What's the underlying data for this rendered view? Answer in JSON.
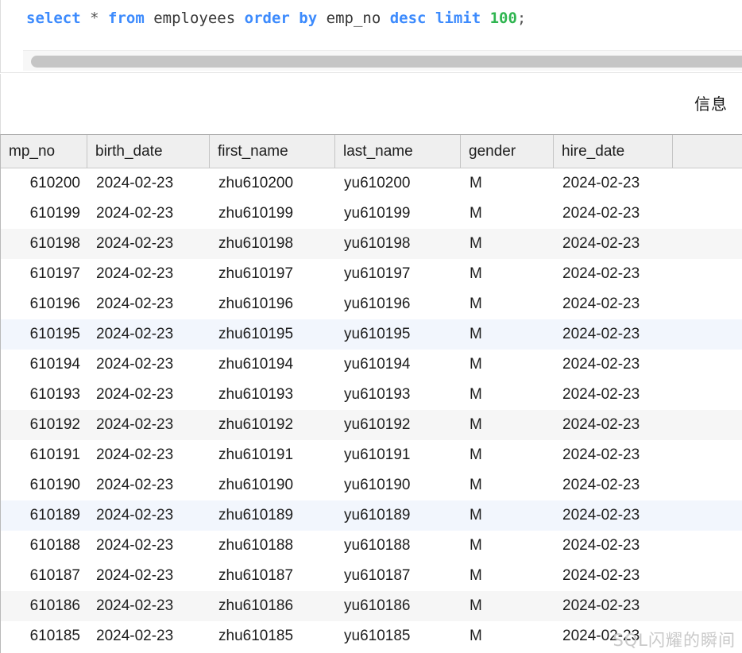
{
  "editor": {
    "query_tokens": [
      {
        "text": "select",
        "type": "keyword"
      },
      {
        "text": " ",
        "type": "plain"
      },
      {
        "text": "*",
        "type": "operator"
      },
      {
        "text": " ",
        "type": "plain"
      },
      {
        "text": "from",
        "type": "keyword"
      },
      {
        "text": " ",
        "type": "plain"
      },
      {
        "text": "employees",
        "type": "identifier"
      },
      {
        "text": " ",
        "type": "plain"
      },
      {
        "text": "order",
        "type": "keyword"
      },
      {
        "text": " ",
        "type": "plain"
      },
      {
        "text": "by",
        "type": "keyword"
      },
      {
        "text": " ",
        "type": "plain"
      },
      {
        "text": "emp_no",
        "type": "identifier"
      },
      {
        "text": " ",
        "type": "plain"
      },
      {
        "text": "desc",
        "type": "keyword"
      },
      {
        "text": " ",
        "type": "plain"
      },
      {
        "text": "limit",
        "type": "keyword"
      },
      {
        "text": " ",
        "type": "plain"
      },
      {
        "text": "100",
        "type": "number"
      },
      {
        "text": ";",
        "type": "punct"
      }
    ],
    "query_text": "select * from employees order by emp_no desc limit 100;"
  },
  "colors": {
    "keyword": "#3d8bfd",
    "number": "#2fb550",
    "identifier": "#383838",
    "stripe_gray": "#f6f6f6",
    "stripe_blue": "#f2f6fd",
    "header_bg": "#efefef"
  },
  "results": {
    "tab_label": "信息",
    "columns": [
      {
        "key": "emp_no",
        "label": "mp_no",
        "full_label": "emp_no",
        "align": "right"
      },
      {
        "key": "birth_date",
        "label": "birth_date",
        "full_label": "birth_date",
        "align": "left"
      },
      {
        "key": "first_name",
        "label": "first_name",
        "full_label": "first_name",
        "align": "left"
      },
      {
        "key": "last_name",
        "label": "last_name",
        "full_label": "last_name",
        "align": "left"
      },
      {
        "key": "gender",
        "label": "gender",
        "full_label": "gender",
        "align": "left"
      },
      {
        "key": "hire_date",
        "label": "hire_date",
        "full_label": "hire_date",
        "align": "left"
      },
      {
        "key": "spacer",
        "label": "",
        "full_label": "",
        "align": "left"
      }
    ],
    "rows": [
      {
        "emp_no": "610200",
        "birth_date": "2024-02-23",
        "first_name": "zhu610200",
        "last_name": "yu610200",
        "gender": "M",
        "hire_date": "2024-02-23",
        "stripe": "none"
      },
      {
        "emp_no": "610199",
        "birth_date": "2024-02-23",
        "first_name": "zhu610199",
        "last_name": "yu610199",
        "gender": "M",
        "hire_date": "2024-02-23",
        "stripe": "none"
      },
      {
        "emp_no": "610198",
        "birth_date": "2024-02-23",
        "first_name": "zhu610198",
        "last_name": "yu610198",
        "gender": "M",
        "hire_date": "2024-02-23",
        "stripe": "gray"
      },
      {
        "emp_no": "610197",
        "birth_date": "2024-02-23",
        "first_name": "zhu610197",
        "last_name": "yu610197",
        "gender": "M",
        "hire_date": "2024-02-23",
        "stripe": "none"
      },
      {
        "emp_no": "610196",
        "birth_date": "2024-02-23",
        "first_name": "zhu610196",
        "last_name": "yu610196",
        "gender": "M",
        "hire_date": "2024-02-23",
        "stripe": "none"
      },
      {
        "emp_no": "610195",
        "birth_date": "2024-02-23",
        "first_name": "zhu610195",
        "last_name": "yu610195",
        "gender": "M",
        "hire_date": "2024-02-23",
        "stripe": "blue"
      },
      {
        "emp_no": "610194",
        "birth_date": "2024-02-23",
        "first_name": "zhu610194",
        "last_name": "yu610194",
        "gender": "M",
        "hire_date": "2024-02-23",
        "stripe": "none"
      },
      {
        "emp_no": "610193",
        "birth_date": "2024-02-23",
        "first_name": "zhu610193",
        "last_name": "yu610193",
        "gender": "M",
        "hire_date": "2024-02-23",
        "stripe": "none"
      },
      {
        "emp_no": "610192",
        "birth_date": "2024-02-23",
        "first_name": "zhu610192",
        "last_name": "yu610192",
        "gender": "M",
        "hire_date": "2024-02-23",
        "stripe": "gray"
      },
      {
        "emp_no": "610191",
        "birth_date": "2024-02-23",
        "first_name": "zhu610191",
        "last_name": "yu610191",
        "gender": "M",
        "hire_date": "2024-02-23",
        "stripe": "none"
      },
      {
        "emp_no": "610190",
        "birth_date": "2024-02-23",
        "first_name": "zhu610190",
        "last_name": "yu610190",
        "gender": "M",
        "hire_date": "2024-02-23",
        "stripe": "none"
      },
      {
        "emp_no": "610189",
        "birth_date": "2024-02-23",
        "first_name": "zhu610189",
        "last_name": "yu610189",
        "gender": "M",
        "hire_date": "2024-02-23",
        "stripe": "blue"
      },
      {
        "emp_no": "610188",
        "birth_date": "2024-02-23",
        "first_name": "zhu610188",
        "last_name": "yu610188",
        "gender": "M",
        "hire_date": "2024-02-23",
        "stripe": "none"
      },
      {
        "emp_no": "610187",
        "birth_date": "2024-02-23",
        "first_name": "zhu610187",
        "last_name": "yu610187",
        "gender": "M",
        "hire_date": "2024-02-23",
        "stripe": "none"
      },
      {
        "emp_no": "610186",
        "birth_date": "2024-02-23",
        "first_name": "zhu610186",
        "last_name": "yu610186",
        "gender": "M",
        "hire_date": "2024-02-23",
        "stripe": "gray"
      },
      {
        "emp_no": "610185",
        "birth_date": "2024-02-23",
        "first_name": "zhu610185",
        "last_name": "yu610185",
        "gender": "M",
        "hire_date": "2024-02-23",
        "stripe": "none"
      }
    ]
  },
  "watermark": {
    "text": "SQL闪耀的瞬间"
  }
}
